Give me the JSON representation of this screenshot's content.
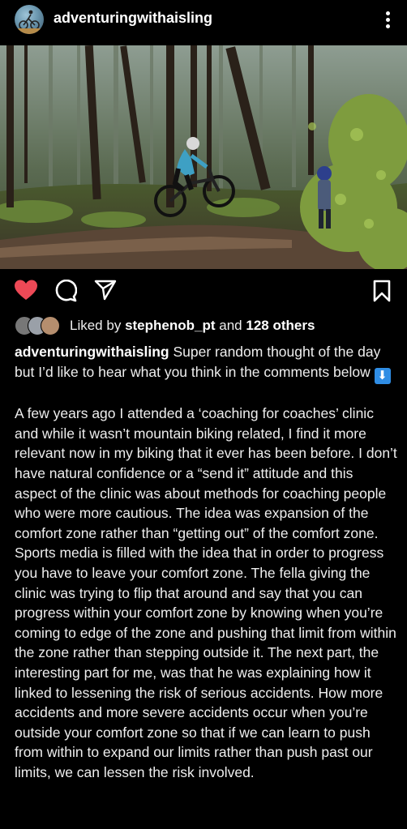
{
  "header": {
    "username": "adventuringwithaisling",
    "avatar_icon": "avatar-cyclist-icon",
    "more_icon": "more-vertical-icon"
  },
  "post": {
    "image_description_icon": "mountain-bike-forest-photo"
  },
  "actions": {
    "like_icon": "heart-filled-icon",
    "comment_icon": "comment-icon",
    "share_icon": "send-icon",
    "save_icon": "bookmark-icon",
    "like_color": "#ed4956"
  },
  "likes": {
    "prefix": "Liked by",
    "user": "stephenob_pt",
    "middle": "and",
    "others": "128 others"
  },
  "caption": {
    "username": "adventuringwithaisling",
    "intro": "Super random thought of the day but I’d like to hear what you think in the comments below",
    "emoji": "⬇",
    "body": "A few years ago I attended a ‘coaching for coaches’ clinic and while it wasn’t mountain biking related, I find it more relevant now in my biking that it ever has been before. I don’t have natural confidence or a “send it” attitude and this aspect of the clinic was about methods for coaching people who were more cautious. The idea was expansion of the comfort zone rather than “getting out” of the comfort zone. Sports media is filled with the idea that in order to progress you have to leave your comfort zone. The fella giving the clinic was trying to flip that around and say that you can progress within your comfort zone by knowing when you’re coming to edge of the zone and pushing that limit from within the zone rather than stepping outside it. The next part, the interesting part for me, was that he was explaining how it linked to lessening the risk of serious accidents. How more accidents and more severe accidents occur when you’re outside your comfort zone so that if we can learn to push from within to expand our limits rather than push past our limits, we can lessen the risk involved."
  }
}
